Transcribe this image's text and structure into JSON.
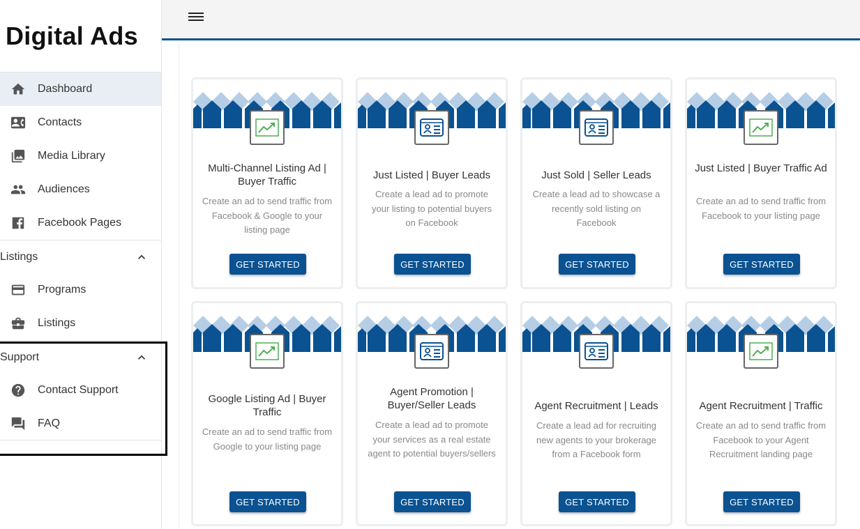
{
  "brand": "Digital Ads",
  "colors": {
    "primary": "#0a5291",
    "accent_green": "#4caf50",
    "active_bg": "#e9eef5"
  },
  "nav": {
    "items": [
      {
        "label": "Dashboard",
        "icon": "home-icon"
      },
      {
        "label": "Contacts",
        "icon": "contact-card-icon"
      },
      {
        "label": "Media Library",
        "icon": "photo-library-icon"
      },
      {
        "label": "Audiences",
        "icon": "people-icon"
      },
      {
        "label": "Facebook Pages",
        "icon": "facebook-icon"
      }
    ],
    "listings": {
      "label": "Listings",
      "items": [
        {
          "label": "Programs",
          "icon": "credit-card-icon"
        },
        {
          "label": "Listings",
          "icon": "briefcase-icon"
        }
      ]
    },
    "support": {
      "label": "Support",
      "items": [
        {
          "label": "Contact Support",
          "icon": "help-icon"
        },
        {
          "label": "FAQ",
          "icon": "forum-icon"
        }
      ]
    }
  },
  "cards": [
    {
      "title": "Multi-Channel Listing Ad | Buyer Traffic",
      "desc": "Create an ad to send traffic from Facebook & Google to your listing page",
      "icon": "trending-up-icon",
      "button": "GET STARTED"
    },
    {
      "title": "Just Listed | Buyer Leads",
      "desc": "Create a lead ad to promote your listing to potential buyers on Facebook",
      "icon": "id-card-icon",
      "button": "GET STARTED"
    },
    {
      "title": "Just Sold | Seller Leads",
      "desc": "Create a lead ad to showcase a recently sold listing on Facebook",
      "icon": "id-card-icon",
      "button": "GET STARTED"
    },
    {
      "title": "Just Listed | Buyer Traffic Ad",
      "desc": "Create an ad to send traffic from Facebook to your listing page",
      "icon": "trending-up-icon",
      "button": "GET STARTED"
    },
    {
      "title": "Google Listing Ad | Buyer Traffic",
      "desc": "Create an ad to send traffic from Google to your listing page",
      "icon": "trending-up-icon",
      "button": "GET STARTED"
    },
    {
      "title": "Agent Promotion | Buyer/Seller Leads",
      "desc": "Create a lead ad to promote your services as a real estate agent to potential buyers/sellers",
      "icon": "id-card-icon",
      "button": "GET STARTED"
    },
    {
      "title": "Agent Recruitment | Leads",
      "desc": "Create a lead ad for recruiting new agents to your brokerage from a Facebook form",
      "icon": "id-card-icon",
      "button": "GET STARTED"
    },
    {
      "title": "Agent Recruitment | Traffic",
      "desc": "Create an ad to send traffic from Facebook to your Agent Recruitment landing page",
      "icon": "trending-up-icon",
      "button": "GET STARTED"
    }
  ]
}
